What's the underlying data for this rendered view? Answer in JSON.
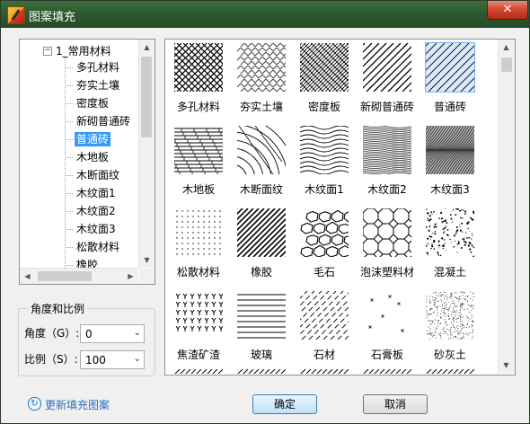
{
  "window": {
    "title": "图案填充",
    "close_symbol": "✕"
  },
  "tree": {
    "root_label": "1_常用材料",
    "expander_symbol": "−",
    "items": [
      "多孔材料",
      "夯实土壤",
      "密度板",
      "新砌普通砖",
      "普通砖",
      "木地板",
      "木断面纹",
      "木纹面1",
      "木纹面2",
      "木纹面3",
      "松散材料",
      "橡胶"
    ],
    "selected_index": 4
  },
  "settings": {
    "group_title": "角度和比例",
    "angle_label": "角度（G）:",
    "angle_value": "0",
    "scale_label": "比例（S）:",
    "scale_value": "100"
  },
  "patterns": [
    {
      "name": "多孔材料",
      "icon": "crosshatch-pattern"
    },
    {
      "name": "夯实土壤",
      "icon": "tamped-soil-pattern"
    },
    {
      "name": "密度板",
      "icon": "fine-crosshatch-pattern"
    },
    {
      "name": "新砌普通砖",
      "icon": "wide-diagonal-pattern"
    },
    {
      "name": "普通砖",
      "icon": "brick-diagonal-pattern",
      "selected": true
    },
    {
      "name": "木地板",
      "icon": "wood-floor-pattern"
    },
    {
      "name": "木断面纹",
      "icon": "wood-section-pattern"
    },
    {
      "name": "木纹面1",
      "icon": "wood-wave-pattern"
    },
    {
      "name": "木纹面2",
      "icon": "dense-wood-pattern"
    },
    {
      "name": "木纹面3",
      "icon": "wood-grain-pattern"
    },
    {
      "name": "松散材料",
      "icon": "dots-pattern"
    },
    {
      "name": "橡胶",
      "icon": "rubber-diagonal-pattern"
    },
    {
      "name": "毛石",
      "icon": "rubble-stone-pattern"
    },
    {
      "name": "泡沫塑料材",
      "icon": "foam-octagon-pattern"
    },
    {
      "name": "混凝土",
      "icon": "concrete-speckle-pattern"
    },
    {
      "name": "焦渣矿渣",
      "icon": "slag-pattern"
    },
    {
      "name": "玻璃",
      "icon": "glass-lines-pattern"
    },
    {
      "name": "石材",
      "icon": "stone-pattern"
    },
    {
      "name": "石膏板",
      "icon": "gypsum-pattern"
    },
    {
      "name": "砂灰土",
      "icon": "sand-lime-pattern"
    }
  ],
  "footer": {
    "update_link": "更新填充图案",
    "ok_label": "确定",
    "cancel_label": "取消"
  },
  "colors": {
    "title_bar": "#2f5a30",
    "selection": "#3399ff",
    "link": "#2a6fc0"
  }
}
